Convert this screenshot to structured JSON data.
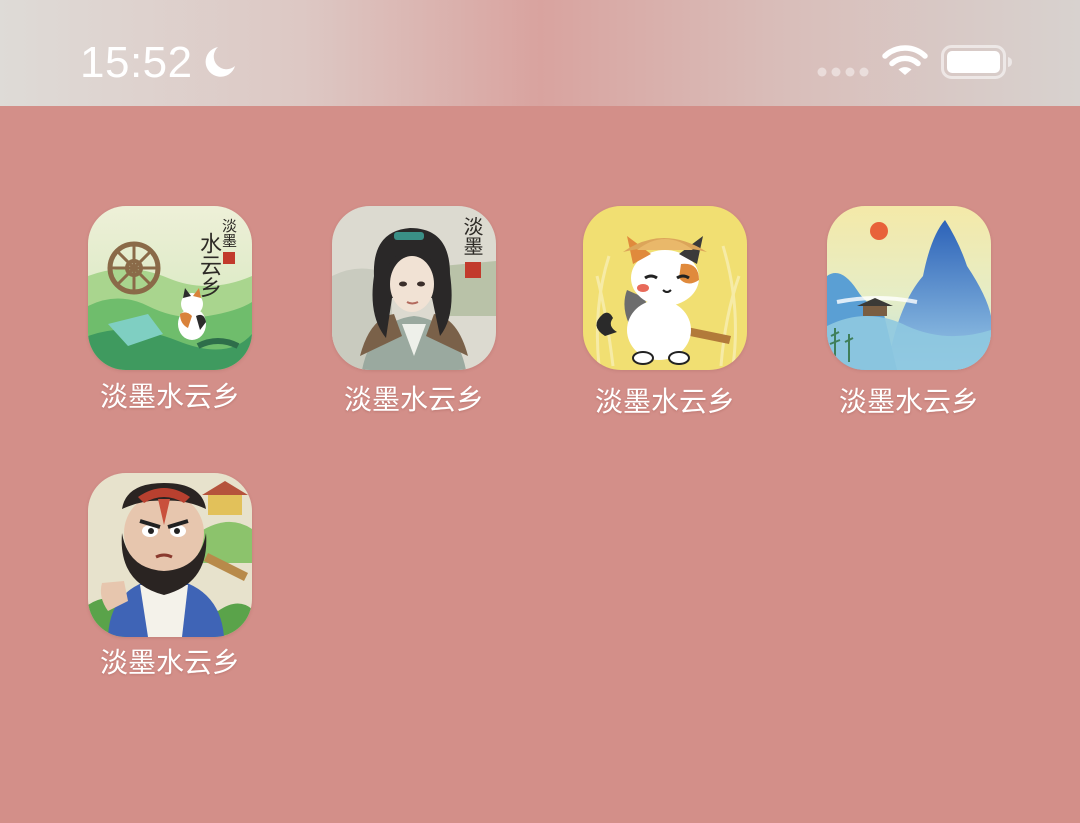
{
  "status_bar": {
    "time": "15:52",
    "focus_icon": "moon-icon",
    "cellular_icon": "signal-dots-icon",
    "wifi_icon": "wifi-icon",
    "battery_icon": "battery-icon"
  },
  "colors": {
    "wallpaper": "#d38f89",
    "status_bar": "#dcd3d0",
    "label_text": "#ffffff"
  },
  "apps": [
    {
      "label": "淡墨水云乡",
      "icon": "waterwheel-landscape-icon",
      "logo_text_top": "淡墨",
      "logo_text_bottom": "水云乡"
    },
    {
      "label": "淡墨水云乡",
      "icon": "swordsman-portrait-icon",
      "logo_text_top": "淡墨"
    },
    {
      "label": "淡墨水云乡",
      "icon": "cat-with-axe-icon"
    },
    {
      "label": "淡墨水云乡",
      "icon": "blue-mountains-icon"
    },
    {
      "label": "淡墨水云乡",
      "icon": "bearded-warrior-icon"
    }
  ]
}
